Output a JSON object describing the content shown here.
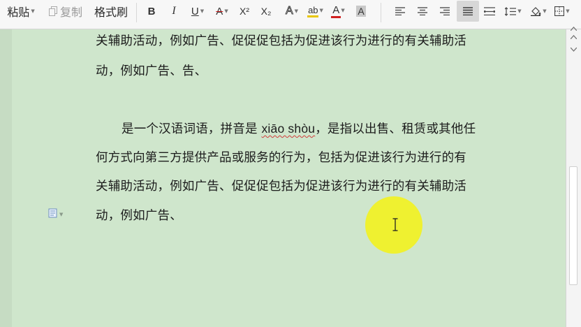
{
  "toolbar": {
    "paste_label": "粘贴",
    "copy_label": "复制",
    "format_painter_label": "格式刷",
    "bold_label": "B",
    "italic_label": "I",
    "underline_label": "U",
    "strike_label": "A",
    "superscript_label": "X²",
    "subscript_label": "X₂",
    "clear_label": "A",
    "highlight_label": "ab",
    "font_color_label": "A",
    "char_shade_label": "A",
    "colors": {
      "highlight": "#e8c600",
      "font_color": "#d02020",
      "strike_color": "#d02020"
    }
  },
  "document": {
    "lines": [
      "关辅助活动，例如广告、促促促包括为促进该行为进行的有关辅助活",
      "动，例如广告、告、",
      "是一个汉语词语，拼音是 ",
      "xiāo shòu",
      "，是指以出售、租赁或其他任",
      "何方式向第三方提供产品或服务的行为，包括为促进该行为进行的有",
      "关辅助活动，例如广告、促促促包括为促进该行为进行的有关辅助活",
      "动，例如广告、"
    ]
  },
  "icons": {
    "paragraph_marker": "paragraph-layout-icon",
    "cursor": "ibeam-cursor-icon"
  },
  "colors": {
    "page_background": "#cfe6cc",
    "cursor_highlight": "#f5f214"
  }
}
